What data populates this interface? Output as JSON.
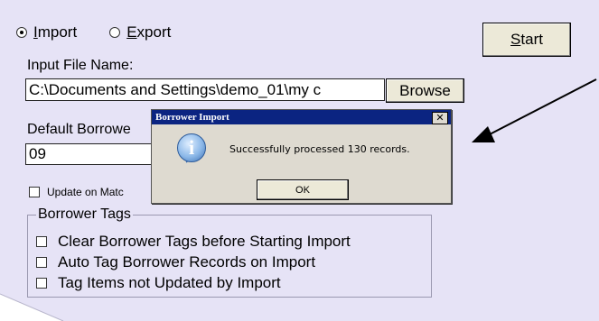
{
  "radio": {
    "import_label": "Import",
    "import_accel": "I",
    "import_rest": "mport",
    "export_label": "Export",
    "export_accel": "E",
    "export_rest": "xport",
    "selected": "import"
  },
  "start_button": {
    "accel": "S",
    "rest": "tart"
  },
  "input_file": {
    "label": "Input File Name:",
    "value": "C:\\Documents and Settings\\demo_01\\my c",
    "browse_label": "Browse"
  },
  "default_borrower": {
    "label": "Default Borrowe",
    "value": "09"
  },
  "update_on_match": {
    "label": "Update on Matc",
    "checked": false
  },
  "borrower_tags": {
    "legend": "Borrower Tags",
    "options": [
      {
        "label": "Clear Borrower Tags before Starting Import",
        "checked": false
      },
      {
        "label": "Auto Tag Borrower Records on Import",
        "checked": false
      },
      {
        "label": "Tag Items not Updated by Import",
        "checked": false
      }
    ]
  },
  "dialog": {
    "title": "Borrower Import",
    "close_glyph": "✕",
    "icon": "info-icon",
    "message": "Successfully processed 130 records.",
    "ok_label": "OK"
  },
  "colors": {
    "background": "#e6e3f6",
    "title_bar": "#0b2481",
    "dialog_bg": "#dedad0"
  }
}
